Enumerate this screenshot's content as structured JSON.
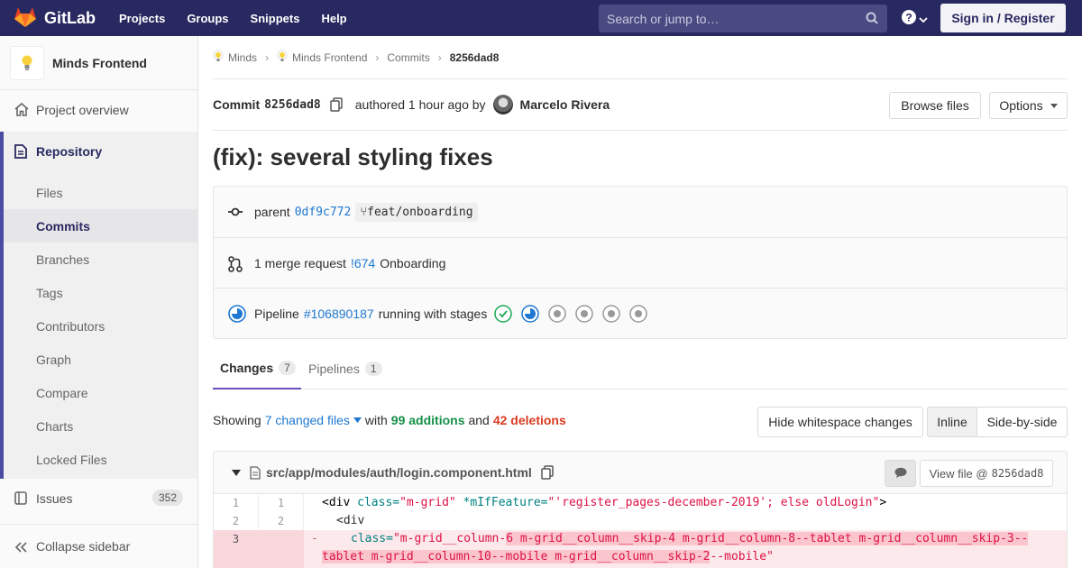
{
  "nav": {
    "brand": "GitLab",
    "links": [
      "Projects",
      "Groups",
      "Snippets",
      "Help"
    ],
    "search_placeholder": "Search or jump to…",
    "signin": "Sign in / Register"
  },
  "sidebar": {
    "project_name": "Minds Frontend",
    "overview": "Project overview",
    "repository": "Repository",
    "repo_items": [
      "Files",
      "Commits",
      "Branches",
      "Tags",
      "Contributors",
      "Graph",
      "Compare",
      "Charts",
      "Locked Files"
    ],
    "active_item": "Commits",
    "issues": "Issues",
    "issues_count": "352",
    "collapse": "Collapse sidebar"
  },
  "breadcrumb": [
    "Minds",
    "Minds Frontend",
    "Commits",
    "8256dad8"
  ],
  "commit": {
    "label": "Commit",
    "sha": "8256dad8",
    "authored": "authored 1 hour ago by",
    "author": "Marcelo Rivera",
    "browse_files": "Browse files",
    "options": "Options",
    "title": "(fix): several styling fixes"
  },
  "info": {
    "parent_label": "parent",
    "parent_sha": "0df9c772",
    "parent_branch": "feat/onboarding",
    "mr_text": "1 merge request",
    "mr_id": "!674",
    "mr_title": "Onboarding",
    "pipeline_label": "Pipeline",
    "pipeline_id": "#106890187",
    "pipeline_status": "running with stages"
  },
  "tabs": {
    "changes": "Changes",
    "changes_count": "7",
    "pipelines": "Pipelines",
    "pipelines_count": "1"
  },
  "showing": {
    "prefix": "Showing",
    "files": "7 changed files",
    "with": "with",
    "additions": "99 additions",
    "and": "and",
    "deletions": "42 deletions"
  },
  "toolbar": {
    "hide_ws": "Hide whitespace changes",
    "inline": "Inline",
    "side_by_side": "Side-by-side"
  },
  "file": {
    "path": "src/app/modules/auth/login.component.html",
    "view_file": "View file @",
    "view_sha": "8256dad8"
  },
  "diff": {
    "l1_old": "1",
    "l1_new": "1",
    "l2_old": "2",
    "l2_new": "2",
    "l3_old": "3",
    "minus": "-",
    "line1": {
      "open": "<div ",
      "a1": "class=",
      "v1": "\"m-grid\"",
      "a2": " *mIfFeature=",
      "v2": "\"'register_pages-december-2019'; else oldLogin\"",
      "close": ">"
    },
    "line2": "<div",
    "line3_attr": "class=",
    "line3_a": "\"m-grid__column-",
    "line3_hl": "6 m-grid__column__skip-4 m-grid__column-8--tablet m-grid__column__skip-3--",
    "line4_hl": "tablet m-grid__column-10--mobile m-grid__column__skip-2",
    "line4_b": "--mobile\""
  }
}
